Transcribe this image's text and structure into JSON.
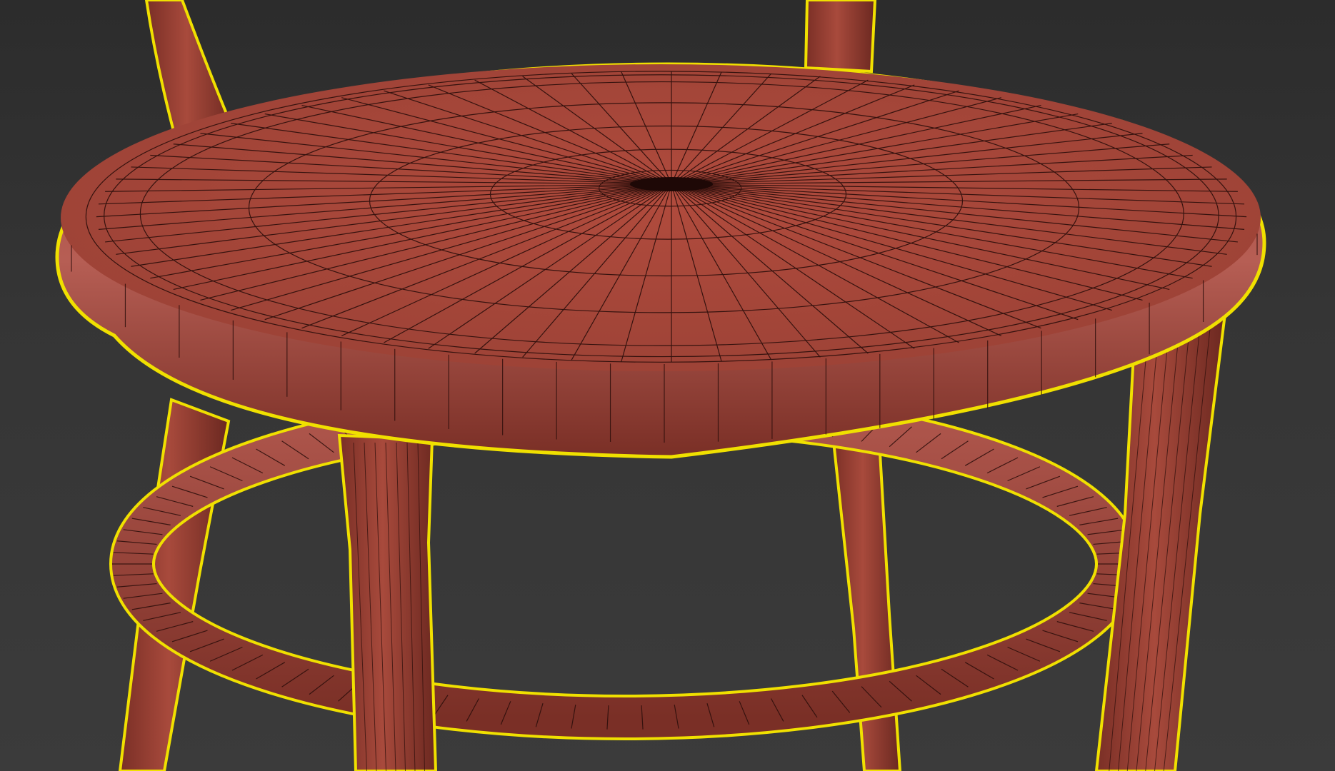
{
  "viewport": {
    "name": "3D viewport",
    "mode": "edged-faces",
    "selected_object": "chair",
    "colors": {
      "background_top": "#2c2c2c",
      "background_bottom": "#3b3b3b",
      "mesh_fill": "#a84a3c",
      "mesh_shade": "#7a2f26",
      "mesh_highlight": "#c98b86",
      "wire": "#2a0d0a",
      "selection_outline": "#f0e000"
    }
  }
}
